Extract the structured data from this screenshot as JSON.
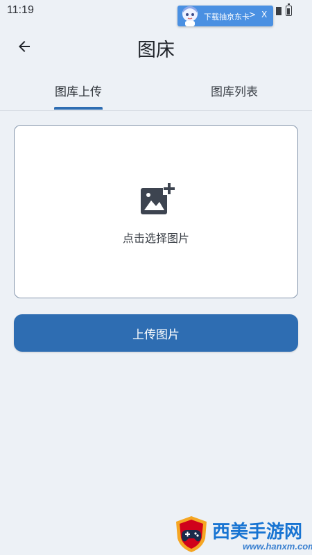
{
  "status_bar": {
    "time": "11:19",
    "ad_text": "下载抽京东卡",
    "ad_arrow": ">",
    "ad_close": "X"
  },
  "app_bar": {
    "back_icon": "arrow-back-icon",
    "title": "图床"
  },
  "tabs": [
    {
      "label": "图库上传",
      "selected": true
    },
    {
      "label": "图库列表",
      "selected": false
    }
  ],
  "picker": {
    "icon": "add-photo-icon",
    "label": "点击选择图片"
  },
  "upload_button": {
    "label": "上传图片"
  },
  "watermark": {
    "text_cn": "西美手游网",
    "text_url": "www.hanxm.com"
  },
  "colors": {
    "background": "#edf1f6",
    "accent": "#2e6db2",
    "card_border": "#8596ac",
    "watermark_blue": "#1874d2"
  }
}
